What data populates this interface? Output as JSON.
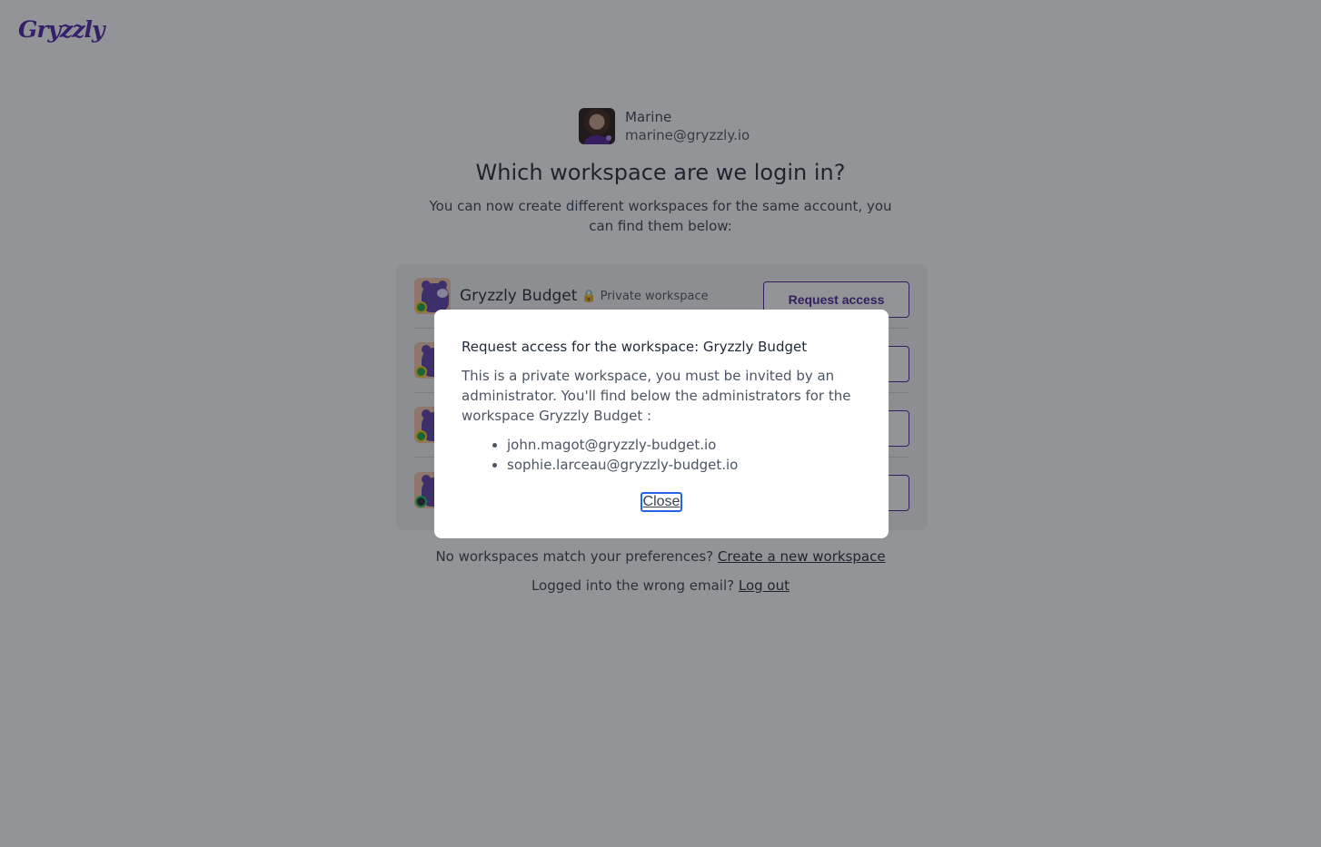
{
  "brand": {
    "logo_text": "Gryzzly",
    "accent": "#4c1d95"
  },
  "user": {
    "name": "Marine",
    "email": "marine@gryzzly.io"
  },
  "heading": "Which workspace are we login in?",
  "subheading": "You can now create different workspaces for the same account, you can find them below:",
  "workspaces": [
    {
      "name": "Gryzzly Budget",
      "lock_icon": "🔒",
      "badge": "Private workspace",
      "button": "Request access"
    }
  ],
  "footer": {
    "no_match_text": "No workspaces match your preferences?",
    "create_link": "Create a new workspace",
    "wrong_email_text": "Logged into the wrong email?",
    "logout_link": "Log out"
  },
  "modal": {
    "title": "Request access for the workspace: Gryzzly Budget",
    "body": "This is a private workspace, you must be invited by an administrator. You'll find below the administrators for the workspace Gryzzly Budget :",
    "admins": [
      "john.magot@gryzzly-budget.io",
      "sophie.larceau@gryzzly-budget.io"
    ],
    "close_label": "Close"
  }
}
